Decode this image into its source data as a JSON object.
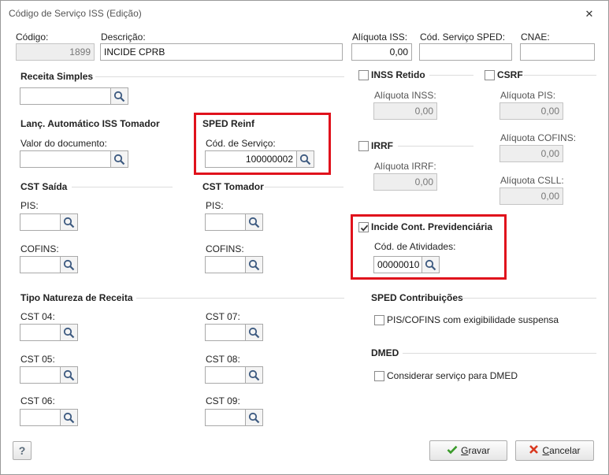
{
  "window": {
    "title": "Código de Serviço ISS (Edição)"
  },
  "fields": {
    "codigo_label": "Código:",
    "codigo_value": "1899",
    "descricao_label": "Descrição:",
    "descricao_value": "INCIDE CPRB",
    "aliquota_iss_label": "Alíquota ISS:",
    "aliquota_iss_value": "0,00",
    "cod_servico_sped_label": "Cód. Serviço SPED:",
    "cod_servico_sped_value": "",
    "cnae_label": "CNAE:",
    "cnae_value": ""
  },
  "receita_simples": {
    "header": "Receita Simples",
    "value": ""
  },
  "lanc_auto": {
    "header": "Lanç. Automático ISS Tomador",
    "valor_label": "Valor do documento:",
    "valor_value": ""
  },
  "sped_reinf": {
    "header": "SPED Reinf",
    "cod_servico_label": "Cód. de Serviço:",
    "cod_servico_value": "100000002"
  },
  "cst_saida": {
    "header": "CST Saída",
    "pis_label": "PIS:",
    "pis_value": "",
    "cofins_label": "COFINS:",
    "cofins_value": ""
  },
  "cst_tomador": {
    "header": "CST Tomador",
    "pis_label": "PIS:",
    "pis_value": "",
    "cofins_label": "COFINS:",
    "cofins_value": ""
  },
  "tipo_natureza": {
    "header": "Tipo Natureza de Receita",
    "cst04": "CST 04:",
    "cst05": "CST 05:",
    "cst06": "CST 06:",
    "cst07": "CST 07:",
    "cst08": "CST 08:",
    "cst09": "CST 09:"
  },
  "inss": {
    "label": "INSS Retido",
    "checked": false,
    "aliquota_label": "Alíquota INSS:",
    "aliquota_value": "0,00"
  },
  "csrf": {
    "label": "CSRF",
    "checked": false,
    "pis_label": "Alíquota PIS:",
    "pis_value": "0,00",
    "cofins_label": "Alíquota COFINS:",
    "cofins_value": "0,00",
    "csll_label": "Alíquota CSLL:",
    "csll_value": "0,00"
  },
  "irrf": {
    "label": "IRRF",
    "checked": false,
    "aliquota_label": "Alíquota IRRF:",
    "aliquota_value": "0,00"
  },
  "incide_cont": {
    "label": "Incide Cont. Previdenciária",
    "checked": true,
    "cod_atividades_label": "Cód. de Atividades:",
    "cod_atividades_value": "00000010"
  },
  "sped_contrib": {
    "header": "SPED Contribuições",
    "pis_cofins_label": "PIS/COFINS com exigibilidade suspensa"
  },
  "dmed": {
    "header": "DMED",
    "considerar_label": "Considerar serviço para DMED"
  },
  "buttons": {
    "help": "?",
    "gravar_first": "G",
    "gravar_rest": "ravar",
    "cancelar_first": "C",
    "cancelar_rest": "ancelar"
  },
  "colors": {
    "highlight": "#e0121c",
    "check_green": "#3a9a2a",
    "cancel_red": "#d9381e"
  }
}
